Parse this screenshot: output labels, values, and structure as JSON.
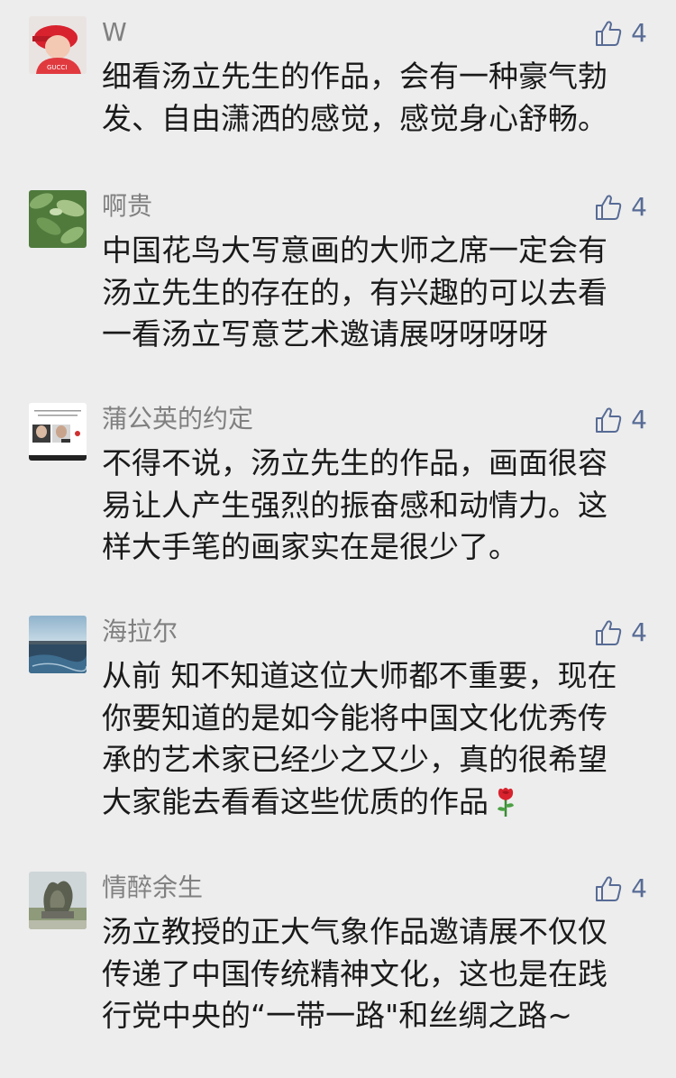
{
  "comments": [
    {
      "name": "W",
      "likes": "4",
      "avatar": "avatar-child-red-cap",
      "lines": [
        "细看汤立先生的作品，会有一种豪气勃",
        "发、自由潇洒的感觉，感觉身心舒畅。"
      ]
    },
    {
      "name": "啊贵",
      "likes": "4",
      "avatar": "avatar-green-leaves",
      "lines": [
        "中国花鸟大写意画的大师之席一定会有",
        "汤立先生的存在的，有兴趣的可以去看",
        "一看汤立写意艺术邀请展呀呀呀呀"
      ]
    },
    {
      "name": "蒲公英的约定",
      "likes": "4",
      "avatar": "avatar-text-photo",
      "lines": [
        "不得不说，汤立先生的作品，画面很容",
        "易让人产生强烈的振奋感和动情力。这",
        "样大手笔的画家实在是很少了。"
      ]
    },
    {
      "name": "海拉尔",
      "likes": "4",
      "avatar": "avatar-lake",
      "lines": [
        "从前 知不知道这位大师都不重要，现在",
        "你要知道的是如今能将中国文化优秀传",
        "承的艺术家已经少之又少，真的很希望",
        "大家能去看看这些优质的作品"
      ],
      "emoji": "rose-icon"
    },
    {
      "name": "情醉余生",
      "likes": "4",
      "avatar": "avatar-sculpture",
      "lines": [
        "汤立教授的正大气象作品邀请展不仅仅",
        "传递了中国传统精神文化，这也是在践",
        "行党中央的“一带一路\"和丝绸之路~"
      ]
    }
  ],
  "colors": {
    "background": "#ededed",
    "name": "#808080",
    "text": "#1a1a1a",
    "like": "#576b95"
  }
}
